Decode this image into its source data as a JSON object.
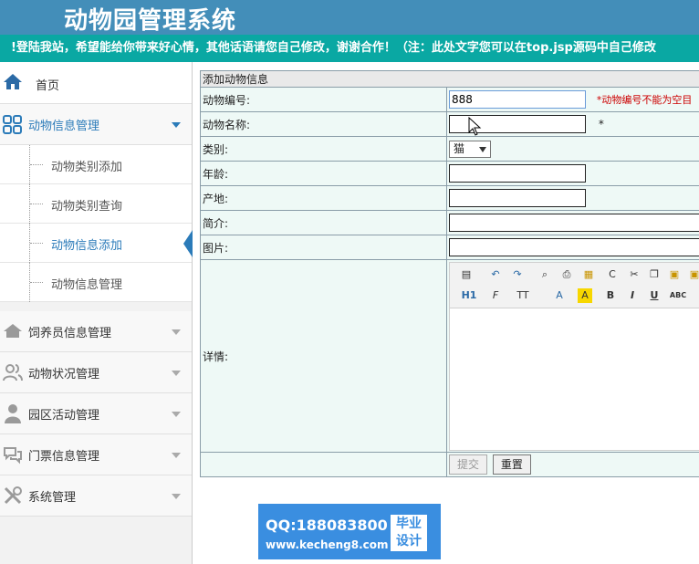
{
  "header": {
    "title": "动物园管理系统",
    "marquee": "!登陆我站，希望能给你带来好心情，其他话语请您自己修改，谢谢合作！（注：此处文字您可以在top.jsp源码中自己修改"
  },
  "sidebar": {
    "home": "首页",
    "animal_info": "动物信息管理",
    "sub_items": [
      "动物类别添加",
      "动物类别查询",
      "动物信息添加",
      "动物信息管理"
    ],
    "menus": [
      "饲养员信息管理",
      "动物状况管理",
      "园区活动管理",
      "门票信息管理",
      "系统管理"
    ]
  },
  "form": {
    "heading": "添加动物信息",
    "labels": {
      "code": "动物编号:",
      "name": "动物名称:",
      "category": "类别:",
      "age": "年龄:",
      "origin": "产地:",
      "intro": "简介:",
      "image": "图片:",
      "detail": "详情:"
    },
    "code_value": "888",
    "code_error": "*动物编号不能为空目",
    "name_required": "*",
    "category_value": "猫",
    "submit": "提交",
    "reset": "重置"
  },
  "editor": {
    "heading_btn": "H1",
    "font_btn": "F",
    "size_btn": "TT",
    "color_btn": "A",
    "bg_btn": "A",
    "bold": "B",
    "italic": "I",
    "underline": "U",
    "strike": "ABC"
  },
  "watermark": {
    "qq": "QQ:188083800",
    "site": "www.kecheng8.com",
    "badge_line1": "毕业",
    "badge_line2": "设计"
  },
  "colors": {
    "header_bg": "#438eb9",
    "marquee_bg": "#0aa8a3",
    "active_blue": "#2b7bb9",
    "form_bg": "#eef9f6"
  }
}
